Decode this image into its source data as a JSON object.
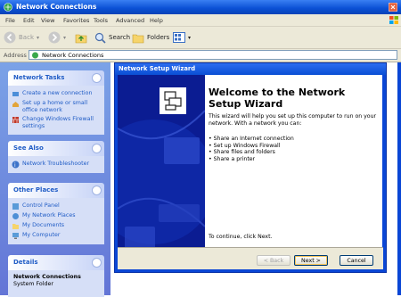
{
  "window": {
    "title": "Network Connections"
  },
  "menu": [
    "File",
    "Edit",
    "View",
    "Favorites",
    "Tools",
    "Advanced",
    "Help"
  ],
  "toolbar": {
    "back_label": "Back",
    "search_label": "Search",
    "folders_label": "Folders"
  },
  "address": {
    "label": "Address",
    "value": "Network Connections"
  },
  "left_pane": {
    "network_tasks": {
      "title": "Network Tasks",
      "items": [
        "Create a new connection",
        "Set up a home or small office network",
        "Change Windows Firewall settings"
      ]
    },
    "see_also": {
      "title": "See Also",
      "items": [
        "Network Troubleshooter"
      ]
    },
    "other_places": {
      "title": "Other Places",
      "items": [
        "Control Panel",
        "My Network Places",
        "My Documents",
        "My Computer"
      ]
    },
    "details": {
      "title": "Details",
      "name": "Network Connections",
      "type": "System Folder"
    }
  },
  "wizard": {
    "title": "Network Setup Wizard",
    "heading": "Welcome to the Network Setup Wizard",
    "intro": "This wizard will help you set up this computer to run on your network. With a network you can:",
    "bullets": [
      "Share an Internet connection",
      "Set up Windows Firewall",
      "Share files and folders",
      "Share a printer"
    ],
    "continue_text": "To continue, click Next.",
    "back_button": "< Back",
    "next_button": "Next >",
    "cancel_button": "Cancel"
  },
  "colors": {
    "xp_blue": "#0a46d5",
    "task_link": "#215dc6",
    "panel_bg": "#d6dff7"
  }
}
